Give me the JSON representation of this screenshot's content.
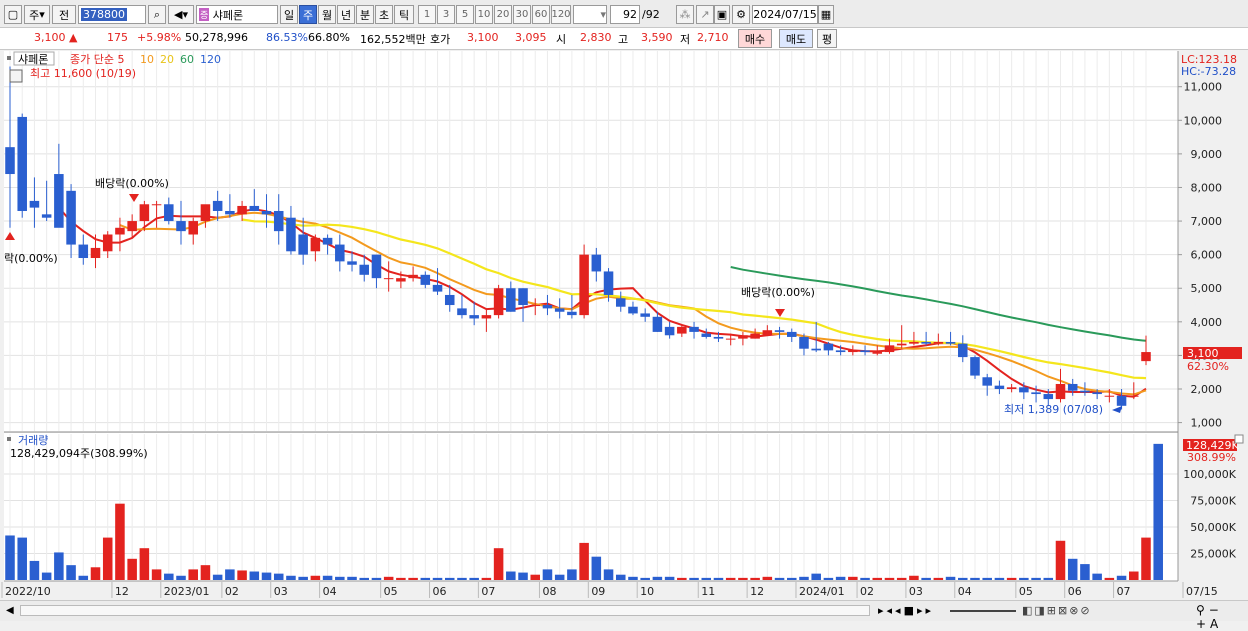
{
  "toolbar": {
    "type_label": "주",
    "prev_label": "전",
    "stock_code": "378800",
    "stock_name": "샤페론",
    "period_day": "일",
    "period_week": "주",
    "period_month": "월",
    "period_year": "년",
    "period_min": "분",
    "period_sec": "초",
    "period_tick": "틱",
    "intervals": [
      "1",
      "3",
      "5",
      "10",
      "20",
      "30",
      "60",
      "120"
    ],
    "count": "92",
    "count_total": "/92",
    "date": "2024/07/15"
  },
  "quote": {
    "price": "3,100",
    "change": "175",
    "change_pct": "+5.98%",
    "volume": "50,278,996",
    "vol_ratio1": "86.53%",
    "vol_ratio2": "66.80%",
    "amount": "162,552백만",
    "hoga_label": "호가",
    "hoga1": "3,100",
    "hoga2": "3,095",
    "open_label": "시",
    "open": "2,830",
    "high_label": "고",
    "high": "3,590",
    "low_label": "저",
    "low": "2,710",
    "buy_label": "매수",
    "sell_label": "매도",
    "avg_label": "평"
  },
  "legend": {
    "name": "샤페론",
    "ma_label": "종가 단순",
    "ma_periods": [
      "5",
      "10",
      "20",
      "60",
      "120"
    ],
    "high_note": "최고 11,600 (10/19)"
  },
  "annotations": {
    "div1": "배당락(0.00%)",
    "div2": "배당락(0.00%)",
    "div0": "락(0.00%)",
    "low_note": "최저 1,389 (07/08)"
  },
  "right_labels": {
    "lc": "LC:123.18",
    "hc": "HC:-73.28",
    "cur_price": "3,100",
    "cur_pct": "62.30%",
    "vol_cur": "128,429K",
    "vol_pct": "308.99%"
  },
  "volume_panel": {
    "title": "거래량",
    "value": "128,429,094주(308.99%)"
  },
  "x_axis_labels": [
    "2022/10",
    "12",
    "2023/01",
    "02",
    "03",
    "04",
    "05",
    "06",
    "07",
    "08",
    "09",
    "10",
    "11",
    "12",
    "2024/01",
    "02",
    "03",
    "04",
    "05",
    "06",
    "07",
    "07/15"
  ],
  "colors": {
    "up": "#e3231f",
    "down": "#2a5fd0",
    "ma5": "#e3231f",
    "ma10": "#f39a1e",
    "ma20": "#f4e61c",
    "ma60": "#2a9a5a"
  },
  "chart_data": [
    {
      "type": "candlestick",
      "title": "샤페론 (378800) 주봉",
      "x": [
        "2022-10-03",
        "2022-10-10",
        "2022-10-17",
        "2022-10-24",
        "2022-10-31",
        "2022-11-07",
        "2022-11-14",
        "2022-11-21",
        "2022-11-28",
        "2022-12-05",
        "2022-12-12",
        "2022-12-19",
        "2022-12-26",
        "2023-01-02",
        "2023-01-09",
        "2023-01-16",
        "2023-01-23",
        "2023-01-30",
        "2023-02-06",
        "2023-02-13",
        "2023-02-20",
        "2023-02-27",
        "2023-03-06",
        "2023-03-13",
        "2023-03-20",
        "2023-03-27",
        "2023-04-03",
        "2023-04-10",
        "2023-04-17",
        "2023-04-24",
        "2023-05-01",
        "2023-05-08",
        "2023-05-15",
        "2023-05-22",
        "2023-05-29",
        "2023-06-05",
        "2023-06-12",
        "2023-06-19",
        "2023-06-26",
        "2023-07-03",
        "2023-07-10",
        "2023-07-17",
        "2023-07-24",
        "2023-07-31",
        "2023-08-07",
        "2023-08-14",
        "2023-08-21",
        "2023-08-28",
        "2023-09-04",
        "2023-09-11",
        "2023-09-18",
        "2023-09-25",
        "2023-10-02",
        "2023-10-09",
        "2023-10-16",
        "2023-10-23",
        "2023-10-30",
        "2023-11-06",
        "2023-11-13",
        "2023-11-20",
        "2023-11-27",
        "2023-12-04",
        "2023-12-11",
        "2023-12-18",
        "2023-12-25",
        "2024-01-01",
        "2024-01-08",
        "2024-01-15",
        "2024-01-22",
        "2024-01-29",
        "2024-02-05",
        "2024-02-12",
        "2024-02-19",
        "2024-02-26",
        "2024-03-04",
        "2024-03-11",
        "2024-03-18",
        "2024-03-25",
        "2024-04-01",
        "2024-04-08",
        "2024-04-15",
        "2024-04-22",
        "2024-04-29",
        "2024-05-06",
        "2024-05-13",
        "2024-05-20",
        "2024-05-27",
        "2024-06-03",
        "2024-06-10",
        "2024-06-17",
        "2024-06-24",
        "2024-07-01",
        "2024-07-08",
        "2024-07-15"
      ],
      "open": [
        9200,
        10100,
        7600,
        7200,
        8400,
        7900,
        6300,
        5900,
        6100,
        6600,
        6700,
        7000,
        7500,
        7500,
        7000,
        6600,
        7000,
        7600,
        7300,
        7200,
        7450,
        7300,
        7300,
        7100,
        6600,
        6100,
        6500,
        6300,
        5800,
        5700,
        6000,
        5300,
        5200,
        5300,
        5400,
        5100,
        4800,
        4400,
        4200,
        4100,
        4200,
        5000,
        5000,
        4500,
        4500,
        4400,
        4300,
        4200,
        6000,
        5500,
        4700,
        4450,
        4250,
        4150,
        3850,
        3650,
        3850,
        3650,
        3550,
        3500,
        3500,
        3500,
        3600,
        3750,
        3700,
        3550,
        3200,
        3350,
        3150,
        3100,
        3150,
        3050,
        3100,
        3300,
        3350,
        3400,
        3350,
        3400,
        3350,
        2950,
        2350,
        2100,
        2000,
        2050,
        1900,
        1850,
        1700,
        2150,
        1950,
        1900,
        1800,
        1800,
        1800,
        2830
      ],
      "high": [
        11600,
        10200,
        8300,
        8200,
        9300,
        8100,
        6600,
        6600,
        6700,
        7100,
        7200,
        7600,
        7600,
        7700,
        7600,
        7100,
        7400,
        7900,
        7800,
        7600,
        7950,
        7800,
        7800,
        7450,
        7100,
        6600,
        6600,
        6600,
        6100,
        6000,
        6000,
        5800,
        5500,
        5650,
        5500,
        5600,
        5100,
        4800,
        4600,
        4400,
        5100,
        5200,
        5000,
        4700,
        4800,
        4700,
        4800,
        6300,
        6200,
        5600,
        4900,
        4600,
        4400,
        4300,
        4000,
        3900,
        4000,
        3800,
        3700,
        3650,
        3700,
        3800,
        3900,
        3850,
        3800,
        3650,
        4000,
        3400,
        3300,
        3300,
        3300,
        3300,
        3500,
        3900,
        3700,
        3700,
        3650,
        3700,
        3600,
        3000,
        2450,
        2250,
        2150,
        2200,
        2100,
        2000,
        2600,
        2300,
        2200,
        2000,
        2000,
        2000,
        2200,
        3590
      ],
      "low": [
        6800,
        7100,
        6800,
        7000,
        7200,
        5900,
        5700,
        5600,
        5900,
        6100,
        6500,
        6700,
        6800,
        6900,
        6300,
        6300,
        6800,
        7000,
        7100,
        7000,
        7300,
        6800,
        6300,
        6000,
        5700,
        5800,
        6000,
        5500,
        5500,
        5200,
        5000,
        4900,
        5000,
        5200,
        5000,
        4800,
        4300,
        4100,
        3900,
        3700,
        4100,
        4300,
        4000,
        4200,
        4200,
        4100,
        4100,
        4100,
        5200,
        4600,
        4300,
        4200,
        4000,
        3700,
        3500,
        3550,
        3500,
        3500,
        3400,
        3300,
        3300,
        3500,
        3600,
        3500,
        3400,
        3000,
        3100,
        3000,
        3000,
        3000,
        3000,
        3000,
        3050,
        3200,
        3300,
        3300,
        3300,
        3300,
        2800,
        2300,
        1800,
        1850,
        1900,
        1700,
        1600,
        1500,
        1600,
        1800,
        1800,
        1700,
        1600,
        1389,
        1700,
        2710
      ],
      "close": [
        8400,
        7300,
        7400,
        7100,
        6800,
        6300,
        5900,
        6200,
        6600,
        6800,
        7000,
        7500,
        7500,
        7000,
        6700,
        7000,
        7500,
        7300,
        7200,
        7450,
        7300,
        7200,
        6700,
        6100,
        6000,
        6500,
        6300,
        5800,
        5700,
        5400,
        5300,
        5300,
        5300,
        5400,
        5100,
        4900,
        4500,
        4200,
        4100,
        4200,
        5000,
        4300,
        4500,
        4500,
        4400,
        4300,
        4200,
        6000,
        5500,
        4800,
        4450,
        4250,
        4150,
        3700,
        3600,
        3850,
        3700,
        3550,
        3500,
        3500,
        3600,
        3650,
        3750,
        3700,
        3550,
        3200,
        3150,
        3150,
        3100,
        3150,
        3100,
        3100,
        3300,
        3350,
        3400,
        3350,
        3400,
        3350,
        2950,
        2400,
        2100,
        2000,
        2050,
        1900,
        1850,
        1700,
        2150,
        1950,
        1900,
        1850,
        1800,
        1500,
        1800,
        3100
      ],
      "ylim": [
        1000,
        11600
      ],
      "yticks": [
        1000,
        2000,
        3000,
        4000,
        5000,
        6000,
        7000,
        8000,
        9000,
        10000,
        11000
      ]
    },
    {
      "type": "bar",
      "title": "거래량",
      "unit": "천주",
      "values": [
        42000,
        40000,
        18000,
        7000,
        26000,
        14000,
        4000,
        12000,
        40000,
        72000,
        20000,
        30000,
        10000,
        6000,
        4000,
        10000,
        14000,
        5000,
        10000,
        9000,
        8000,
        7000,
        6000,
        4000,
        3000,
        4000,
        4000,
        3000,
        3000,
        2000,
        2000,
        3000,
        2000,
        2000,
        2000,
        2000,
        2000,
        2000,
        2000,
        2000,
        30000,
        8000,
        7000,
        5000,
        10000,
        5000,
        10000,
        35000,
        22000,
        10000,
        5000,
        3000,
        2000,
        3000,
        3000,
        2000,
        2000,
        2000,
        2000,
        2000,
        2000,
        2000,
        3000,
        2000,
        2000,
        3000,
        6000,
        2000,
        3000,
        3000,
        2000,
        2000,
        2000,
        2000,
        4000,
        2000,
        2000,
        3000,
        2000,
        2000,
        2000,
        2000,
        2000,
        2000,
        2000,
        2000,
        37000,
        20000,
        15000,
        6000,
        2000,
        4000,
        8000,
        40000,
        128429
      ],
      "yticks": [
        25000,
        50000,
        75000,
        100000
      ]
    }
  ]
}
